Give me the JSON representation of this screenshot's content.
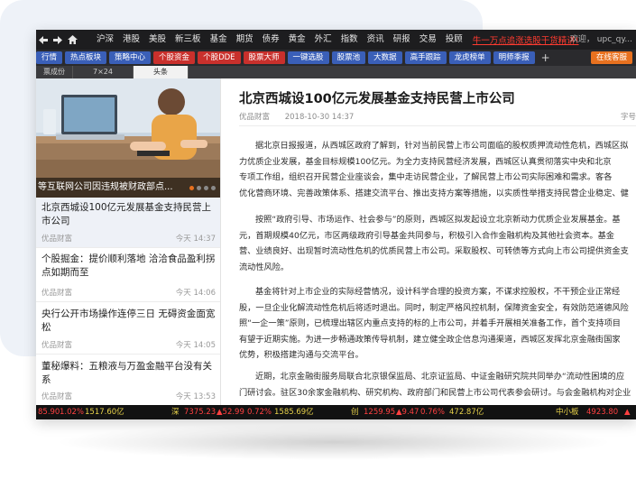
{
  "topbar": {
    "menu": [
      "沪深",
      "港股",
      "美股",
      "新三板",
      "基金",
      "期货",
      "债券",
      "黄金",
      "外汇",
      "指数",
      "资讯",
      "研报",
      "交易",
      "投顾"
    ],
    "promo": "牛一万点追涨选股干货精讲!",
    "user": "欢迎， upc_qy..."
  },
  "toolbar": {
    "buttons": [
      "行情",
      "热点板块",
      "策略中心",
      "个股资金",
      "个股DDE",
      "股票大师",
      "一键选股",
      "股票池",
      "大数据",
      "高手跟踪",
      "龙虎榜单",
      "明师季报"
    ],
    "service": "在线客服"
  },
  "tabs": [
    "票成份",
    "7×24",
    "头条"
  ],
  "hero": {
    "caption": "等互联网公司因违规被财政部点..."
  },
  "news_list": [
    {
      "title": "北京西城设100亿元发展基金支持民营上市公司",
      "source": "优品财富",
      "time": "今天 14:37"
    },
    {
      "title": "个股掘金：提价顺利落地 洽洽食品盈利拐点如期而至",
      "source": "优品财富",
      "time": "今天 14:06"
    },
    {
      "title": "央行公开市场操作连停三日 无碍资金面宽松",
      "source": "优品财富",
      "time": "今天 14:05"
    },
    {
      "title": "董秘爆料：五粮液与万盈金融平台没有关系",
      "source": "优品财富",
      "time": "今天 13:53"
    }
  ],
  "article": {
    "title": "北京西城设100亿元发展基金支持民营上市公司",
    "source": "优品财富",
    "datetime": "2018-10-30 14:37",
    "font_label": "字号",
    "paragraphs": [
      [
        "据北京日报报道，从西城区政府了解到，针对当前民营上市公司面临的股权质押流动性危机，西城区拟",
        "力优质企业发展，基金目标规模100亿元。为全力支持民营经济发展，西城区认真贯彻落实中央和北京",
        "专项工作组，组织召开民营企业座谈会，集中走访民营企业，了解民营上市公司实际困难和需求。客各",
        "优化营商环境、完善政策体系、搭建交流平台、推出支持方案等措施，以实质性举措支持民营企业稳定、健"
      ],
      [
        "按照“政府引导、市场运作、社会参与”的原则，西城区拟发起设立北京新动力优质企业发展基金。基",
        "元，首期规模40亿元，市区两级政府引导基金共同参与，积极引入合作金融机构及其他社会资本。基金",
        "营、业绩良好、出现暂时流动性危机的优质民营上市公司。采取股权、可转债等方式向上市公司提供资金支",
        "流动性风险。"
      ],
      [
        "基金将针对上市企业的实际经营情况，设计科学合理的投资方案，不谋求控股权，不干预企业正常经",
        "股，一旦企业化解流动性危机后将适时退出。同时，制定严格风控机制，保障资金安全，有效防范道德风险",
        "照“一企一策”原则，已梳理出辖区内重点支持的标的上市公司，并着手开展相关准备工作，首个支持项目",
        "有望于近期实施。为进一步畅通政策传导机制，建立健全政企信息沟通渠道，西城区发挥北京金融街国家",
        "优势，积极搭建沟通与交流平台。"
      ],
      [
        "近期，北京金融街服务局联合北京银保监局、北京证监局、中证金融研究院共同举办“流动性困境的应",
        "门研讨会。驻区30余家金融机构、研究机构、政府部门和民营上市公司代表参会研讨。与会金融机构对企业"
      ]
    ]
  },
  "ticker": {
    "items": [
      "85.90",
      "1.02%",
      "1517.60亿",
      "深",
      "7375.23",
      "▲52.99",
      "0.72%",
      "1585.69亿",
      "创",
      "1259.95",
      "▲9.47",
      "0.76%",
      "472.87亿",
      "中小板",
      "4923.80",
      "▲"
    ]
  }
}
